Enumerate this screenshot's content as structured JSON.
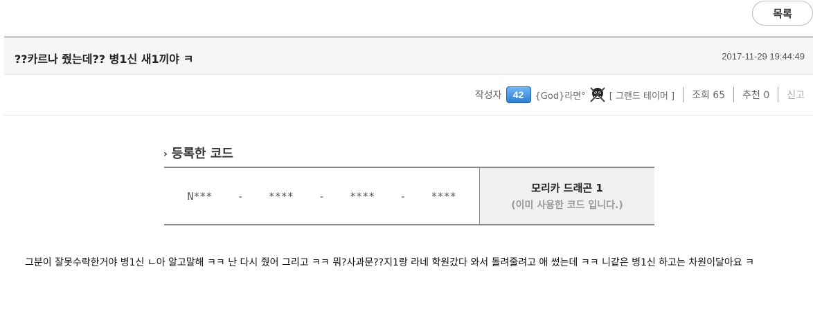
{
  "toolbar": {
    "list_label": "목록"
  },
  "post": {
    "title": "??카르나 줬는데?? 병1신 새1끼야 ㅋ",
    "date": "2017-11-29 19:44:49",
    "body": "그분이 잘못수락한거야 병1신 ㄴ아 알고말해 ㅋㅋ 난 다시 줬어 그리고 ㅋㅋ 뭐?사과문??지1랑 라네 학원갔다 와서 돌려줄려고 애 썼는데 ㅋㅋ 니같은 병1신 하고는 차원이달아요 ㅋ"
  },
  "author": {
    "label": "작성자",
    "level": "42",
    "nickname": "{God}라면°",
    "guild": "[ 그랜드 테이머 ]"
  },
  "stats": {
    "views_label": "조회 65",
    "recommend_label": "추천 0",
    "report_label": "신고"
  },
  "code_section": {
    "title": "등록한 코드",
    "code": "N***    -    ****    -    ****    -    ****",
    "prize": "모리카 드래곤 1",
    "status": "(이미 사용한 코드 입니다.)"
  }
}
